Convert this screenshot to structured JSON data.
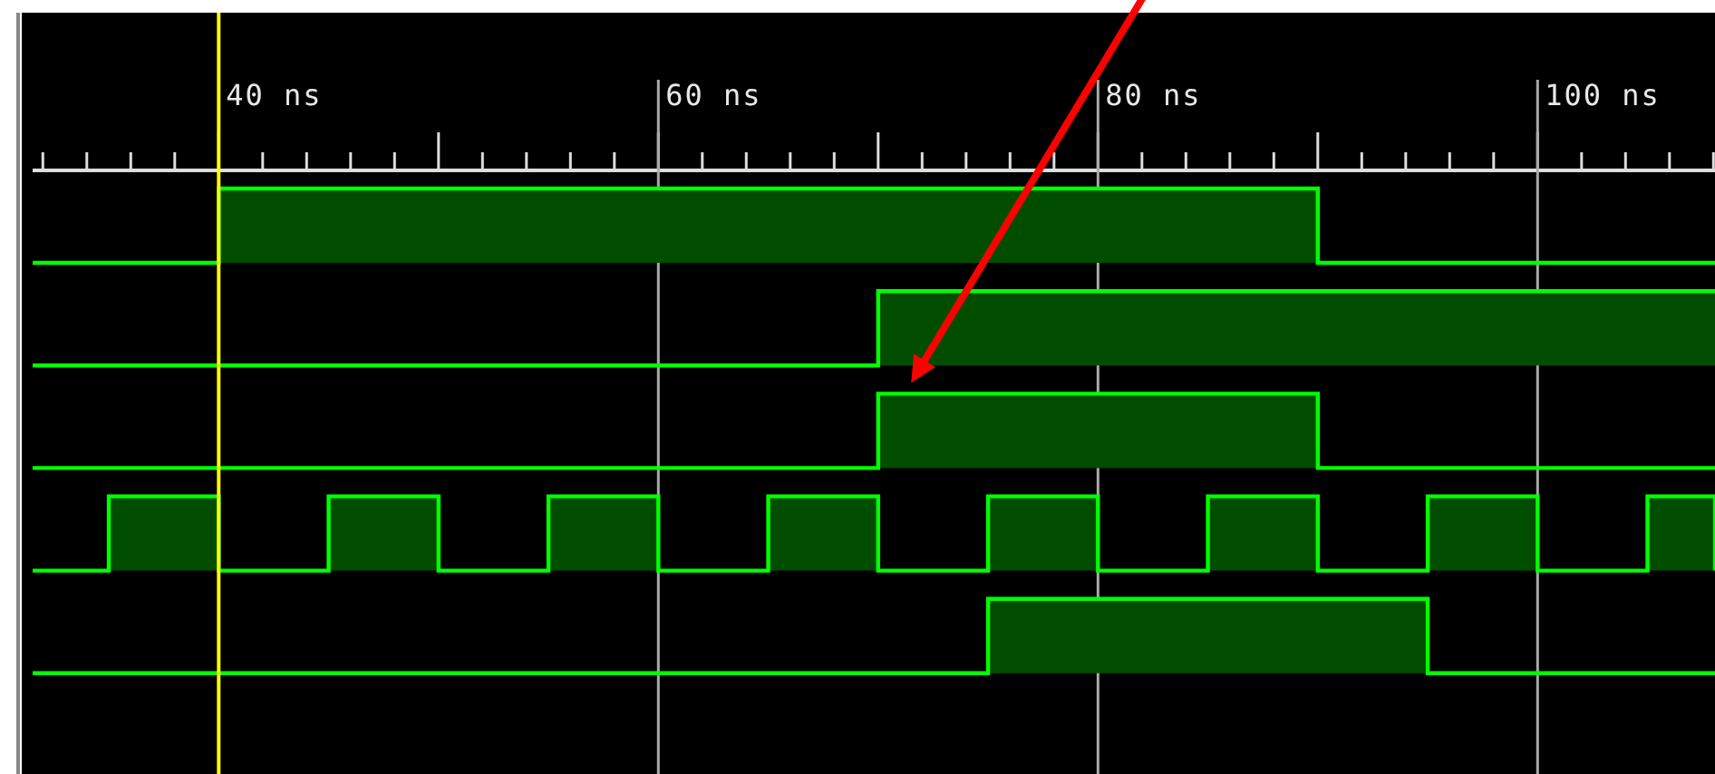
{
  "waveform_view": {
    "time_ruler": {
      "labels": [
        "40 ns",
        "60 ns",
        "80 ns",
        "100 ns"
      ]
    }
  }
}
